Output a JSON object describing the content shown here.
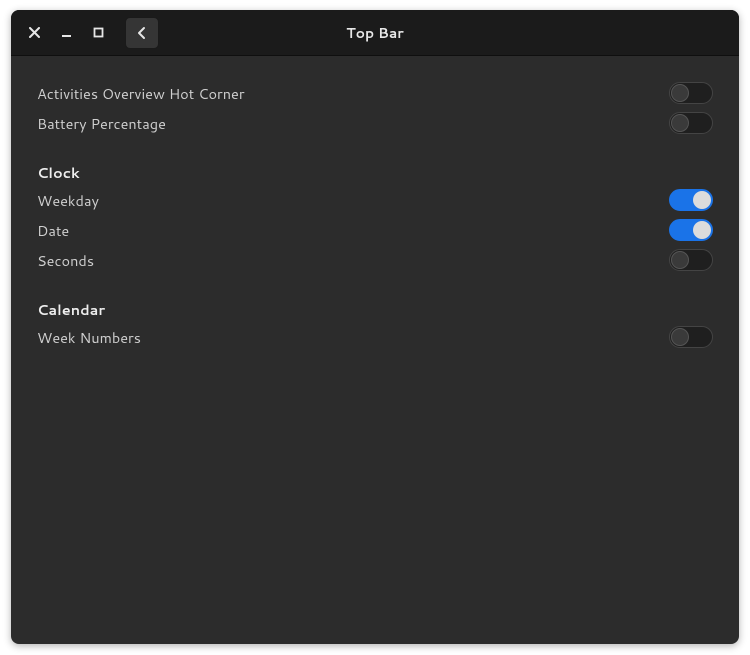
{
  "window": {
    "title": "Top Bar"
  },
  "settings": {
    "activities_hot_corner": {
      "label": "Activities Overview Hot Corner",
      "value": false
    },
    "battery_percentage": {
      "label": "Battery Percentage",
      "value": false
    }
  },
  "sections": {
    "clock": {
      "title": "Clock",
      "weekday": {
        "label": "Weekday",
        "value": true
      },
      "date": {
        "label": "Date",
        "value": true
      },
      "seconds": {
        "label": "Seconds",
        "value": false
      }
    },
    "calendar": {
      "title": "Calendar",
      "week_numbers": {
        "label": "Week Numbers",
        "value": false
      }
    }
  }
}
